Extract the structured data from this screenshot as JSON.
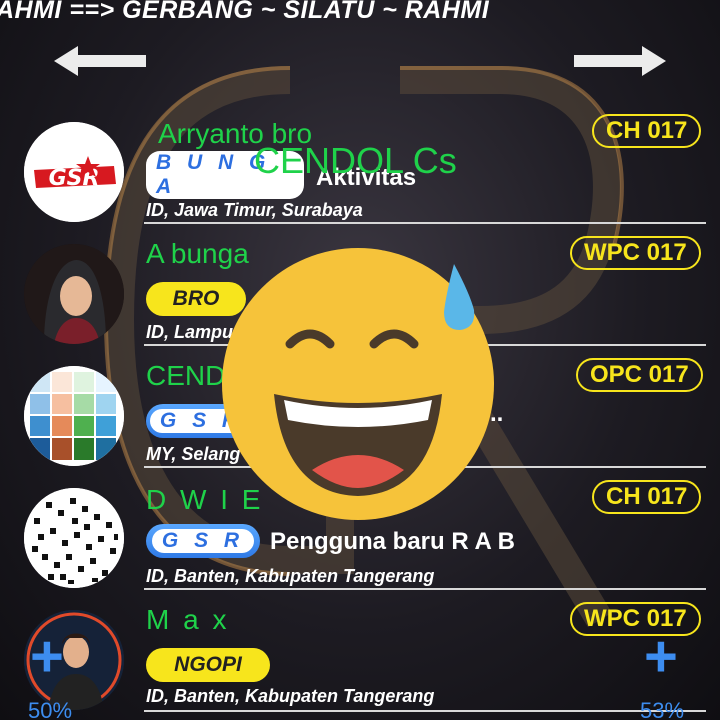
{
  "marquee": "AHMI     ==> GERBANG ~ SILATU ~ RAHMI",
  "overlay_text": "CENDOL Cs",
  "colors": {
    "name_green": "#1fd24a",
    "accent_yellow": "#f7e51c",
    "pill_blue": "#2f7ae6",
    "text_white": "#ffffff"
  },
  "users": [
    {
      "name": "Arryanto bro",
      "name_color": "#1fd24a",
      "tag": "B U N G A",
      "tag_style": "blue",
      "activity": "Aktivitas",
      "location": "ID, Jawa Timur, Surabaya",
      "badge": "CH 017",
      "avatar": "GSR"
    },
    {
      "name": "A bunga",
      "name_color": "#1fd24a",
      "tag": "BRO",
      "tag_style": "yellow",
      "activity": "",
      "location": "ID, Lampu",
      "badge": "WPC 017",
      "avatar": "photo-hijab"
    },
    {
      "name": "CEND",
      "name_color": "#1fd24a",
      "tag": "G S R",
      "tag_style": "blue",
      "activity": "..",
      "location": "MY, Selang",
      "badge": "OPC 017",
      "avatar": "color-grid"
    },
    {
      "name": "D W I E",
      "name_color": "#1fd24a",
      "tag": "G S R",
      "tag_style": "blue",
      "activity": "Pengguna baru R A B",
      "location": "ID, Banten, Kabupaten Tangerang",
      "badge": "CH 017",
      "avatar": "qr-pattern"
    },
    {
      "name": "M a x",
      "name_color": "#1fd24a",
      "tag": "NGOPI",
      "tag_style": "yellow",
      "activity": "",
      "location": "ID, Banten, Kabupaten Tangerang",
      "badge": "WPC 017",
      "avatar": "photo-man"
    }
  ],
  "left_control": {
    "icon": "plus-icon",
    "percent": "50%"
  },
  "right_control": {
    "icon": "plus-icon",
    "percent": "53%"
  },
  "icons": {
    "back": "arrow-left-icon",
    "forward": "arrow-right-icon",
    "emoji": "grinning-sweat-emoji"
  }
}
